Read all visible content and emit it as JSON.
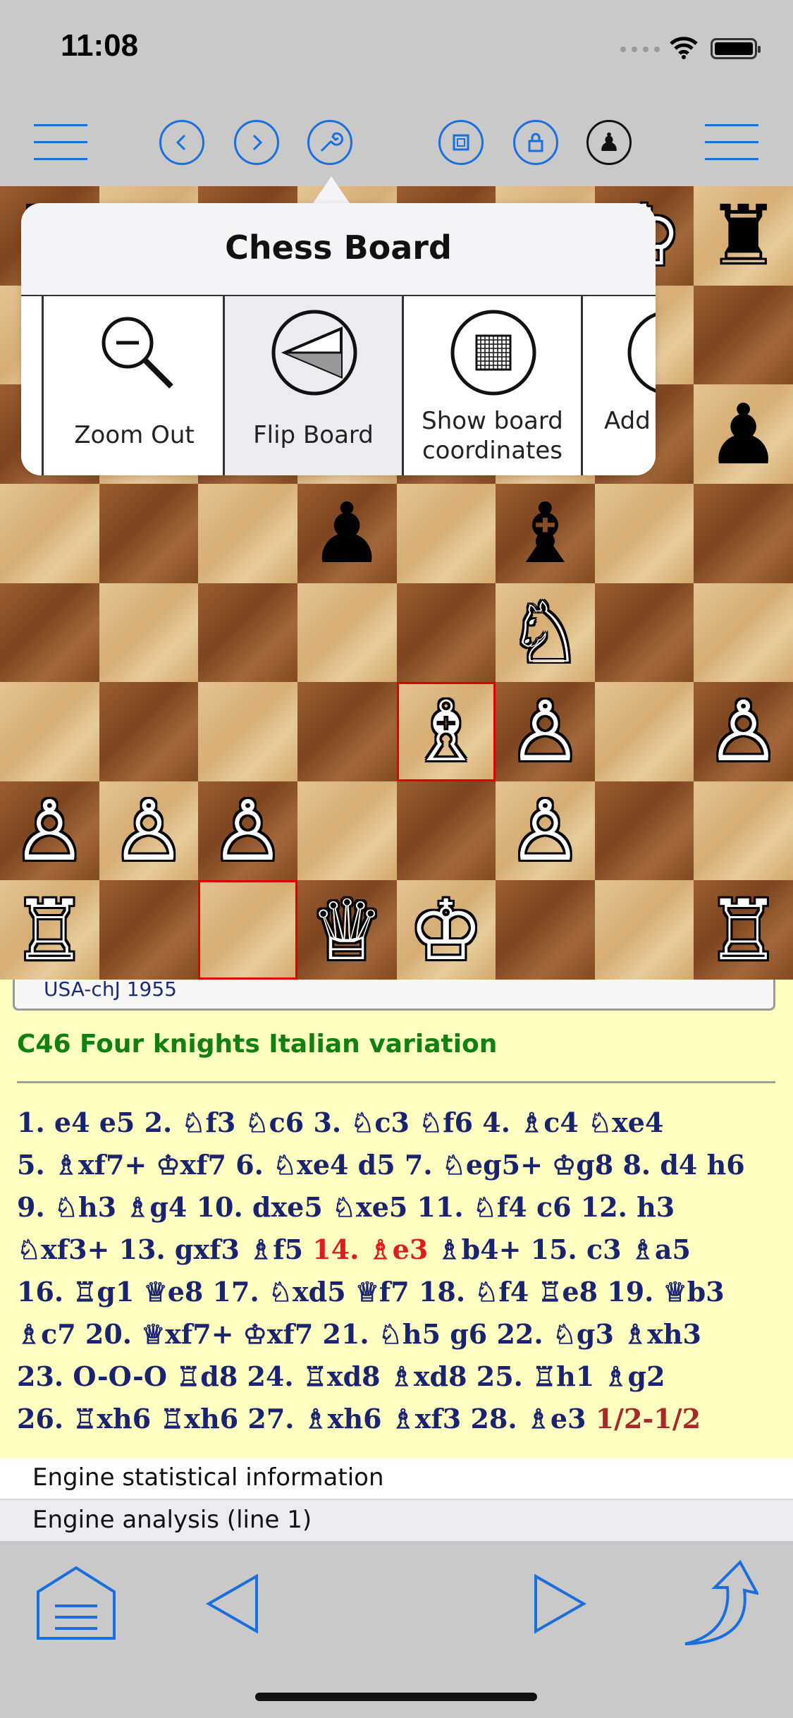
{
  "status": {
    "time": "11:08"
  },
  "toolbar": {
    "buttons": [
      "menu-left",
      "back",
      "forward",
      "tools",
      "engine",
      "lock",
      "player",
      "menu-right"
    ]
  },
  "popover": {
    "title": "Chess Board",
    "items": [
      {
        "label_1": "Zoom Out",
        "label_2": ""
      },
      {
        "label_1": "Flip Board",
        "label_2": ""
      },
      {
        "label_1": "Show board",
        "label_2": "coordinates"
      },
      {
        "label_1": "Add",
        "label_2": ""
      }
    ]
  },
  "game": {
    "event": "USA-chJ 1955",
    "opening": "C46 Four knights Italian variation",
    "moves_lines": [
      "1. e4 e5 2. ♘f3 ♘c6 3. ♘c3 ♘f6 4. ♗c4 ♘xe4",
      "5. ♗xf7+ ♔xf7 6. ♘xe4 d5 7. ♘eg5+ ♔g8 8. d4 h6",
      "9. ♘h3 ♗g4 10. dxe5 ♘xe5 11. ♘f4 c6 12. h3",
      "♘xf3+ 13. gxf3 ♗f5 ",
      "14. ♗e3",
      " ♗b4+ 15. c3 ♗a5",
      "16. ♖g1 ♕e8 17. ♘xd5 ♕f7 18. ♘f4 ♖e8 19. ♕b3",
      "♗c7 20. ♕xf7+ ♔xf7 21. ♘h5 g6 22. ♘g3 ♗xh3",
      "23. O-O-O ♖d8 24. ♖xd8 ♗xd8 25. ♖h1 ♗g2",
      "26. ♖xh6 ♖xh6 27. ♗xh6 ♗xf3 28. ♗e3 ",
      "1/2-1/2"
    ]
  },
  "panels": {
    "engine_stats": "Engine statistical information",
    "engine_analysis": "Engine analysis (line 1)"
  },
  "board": {
    "pieces": [
      {
        "sq": "a8",
        "p": "♜",
        "c": "b"
      },
      {
        "sq": "f8",
        "p": "♝",
        "c": "b"
      },
      {
        "sq": "g8",
        "p": "♔",
        "c": "w"
      },
      {
        "sq": "h8",
        "p": "♜",
        "c": "b"
      },
      {
        "sq": "h6",
        "p": "♟",
        "c": "b"
      },
      {
        "sq": "d5",
        "p": "♟",
        "c": "b"
      },
      {
        "sq": "f5",
        "p": "♝",
        "c": "b"
      },
      {
        "sq": "f4",
        "p": "♘",
        "c": "w"
      },
      {
        "sq": "e3",
        "p": "♗",
        "c": "w"
      },
      {
        "sq": "f3",
        "p": "♙",
        "c": "w"
      },
      {
        "sq": "h3",
        "p": "♙",
        "c": "w"
      },
      {
        "sq": "a2",
        "p": "♙",
        "c": "w"
      },
      {
        "sq": "b2",
        "p": "♙",
        "c": "w"
      },
      {
        "sq": "c2",
        "p": "♙",
        "c": "w"
      },
      {
        "sq": "f2",
        "p": "♙",
        "c": "w"
      },
      {
        "sq": "a1",
        "p": "♖",
        "c": "w"
      },
      {
        "sq": "d1",
        "p": "♕",
        "c": "w"
      },
      {
        "sq": "e1",
        "p": "♔",
        "c": "w"
      },
      {
        "sq": "h1",
        "p": "♖",
        "c": "w"
      }
    ],
    "highlights": [
      "e3",
      "c1"
    ]
  }
}
